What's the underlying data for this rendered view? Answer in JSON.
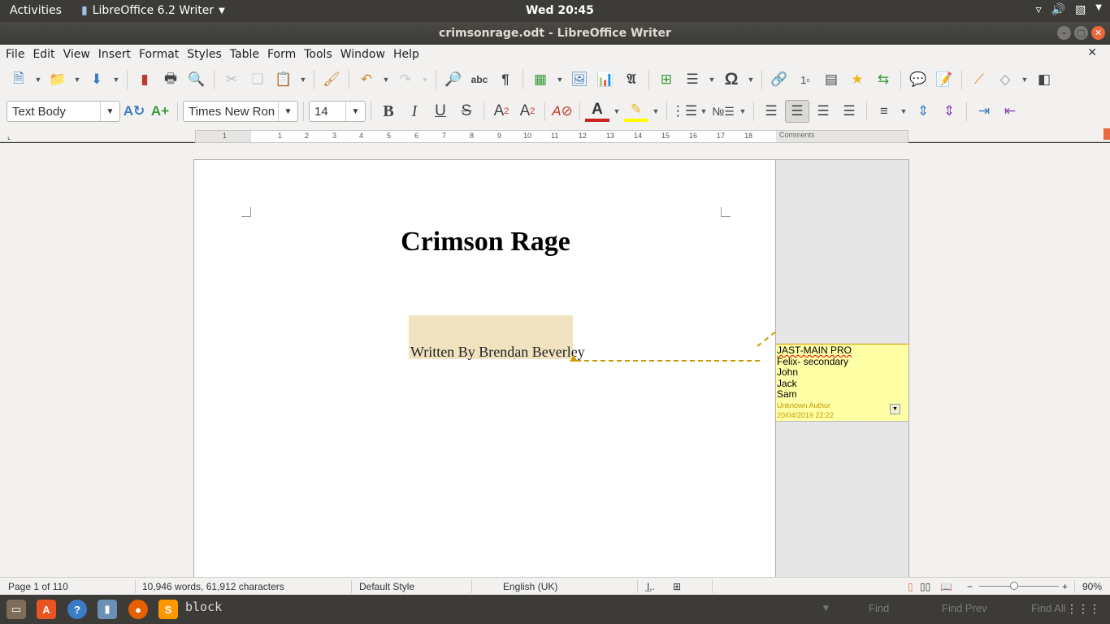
{
  "system": {
    "activities": "Activities",
    "app_menu": "LibreOffice 6.2 Writer",
    "clock": "Wed 20:45"
  },
  "window": {
    "title": "crimsonrage.odt - LibreOffice Writer"
  },
  "menu": [
    "File",
    "Edit",
    "View",
    "Insert",
    "Format",
    "Styles",
    "Table",
    "Form",
    "Tools",
    "Window",
    "Help"
  ],
  "formatting": {
    "paragraph_style": "Text Body",
    "font_name": "Times New Ron",
    "font_size": "14",
    "bold": "B",
    "italic": "I",
    "underline": "U",
    "strike": "S",
    "super": "A",
    "sub": "A"
  },
  "ruler": {
    "numbers": [
      "1",
      "1",
      "2",
      "3",
      "4",
      "5",
      "6",
      "7",
      "8",
      "9",
      "10",
      "11",
      "12",
      "13",
      "14",
      "15",
      "16",
      "17",
      "18"
    ],
    "comments_label": "Comments"
  },
  "document": {
    "title": "Crimson Rage",
    "author_line": "Written By Brendan Beverley"
  },
  "comment": {
    "lines": [
      "JAST-MAIN PRO",
      "Felix- secondary",
      "John",
      "Jack",
      "Sam"
    ],
    "author": "Unknown Author",
    "date": "20/04/2019 22:22"
  },
  "status": {
    "page": "Page 1 of 110",
    "words": "10,946 words, 61,912 characters",
    "page_style": "Default Style",
    "language": "English (UK)",
    "zoom": "90%"
  },
  "taskbar": {
    "find_text": "block",
    "find": "Find",
    "find_prev": "Find Prev",
    "find_all": "Find All"
  },
  "colors": {
    "accent": "#e9683d",
    "comment_bg": "#ffffa6",
    "highlight": "#f1e2c0",
    "anchor": "#d29a00"
  }
}
